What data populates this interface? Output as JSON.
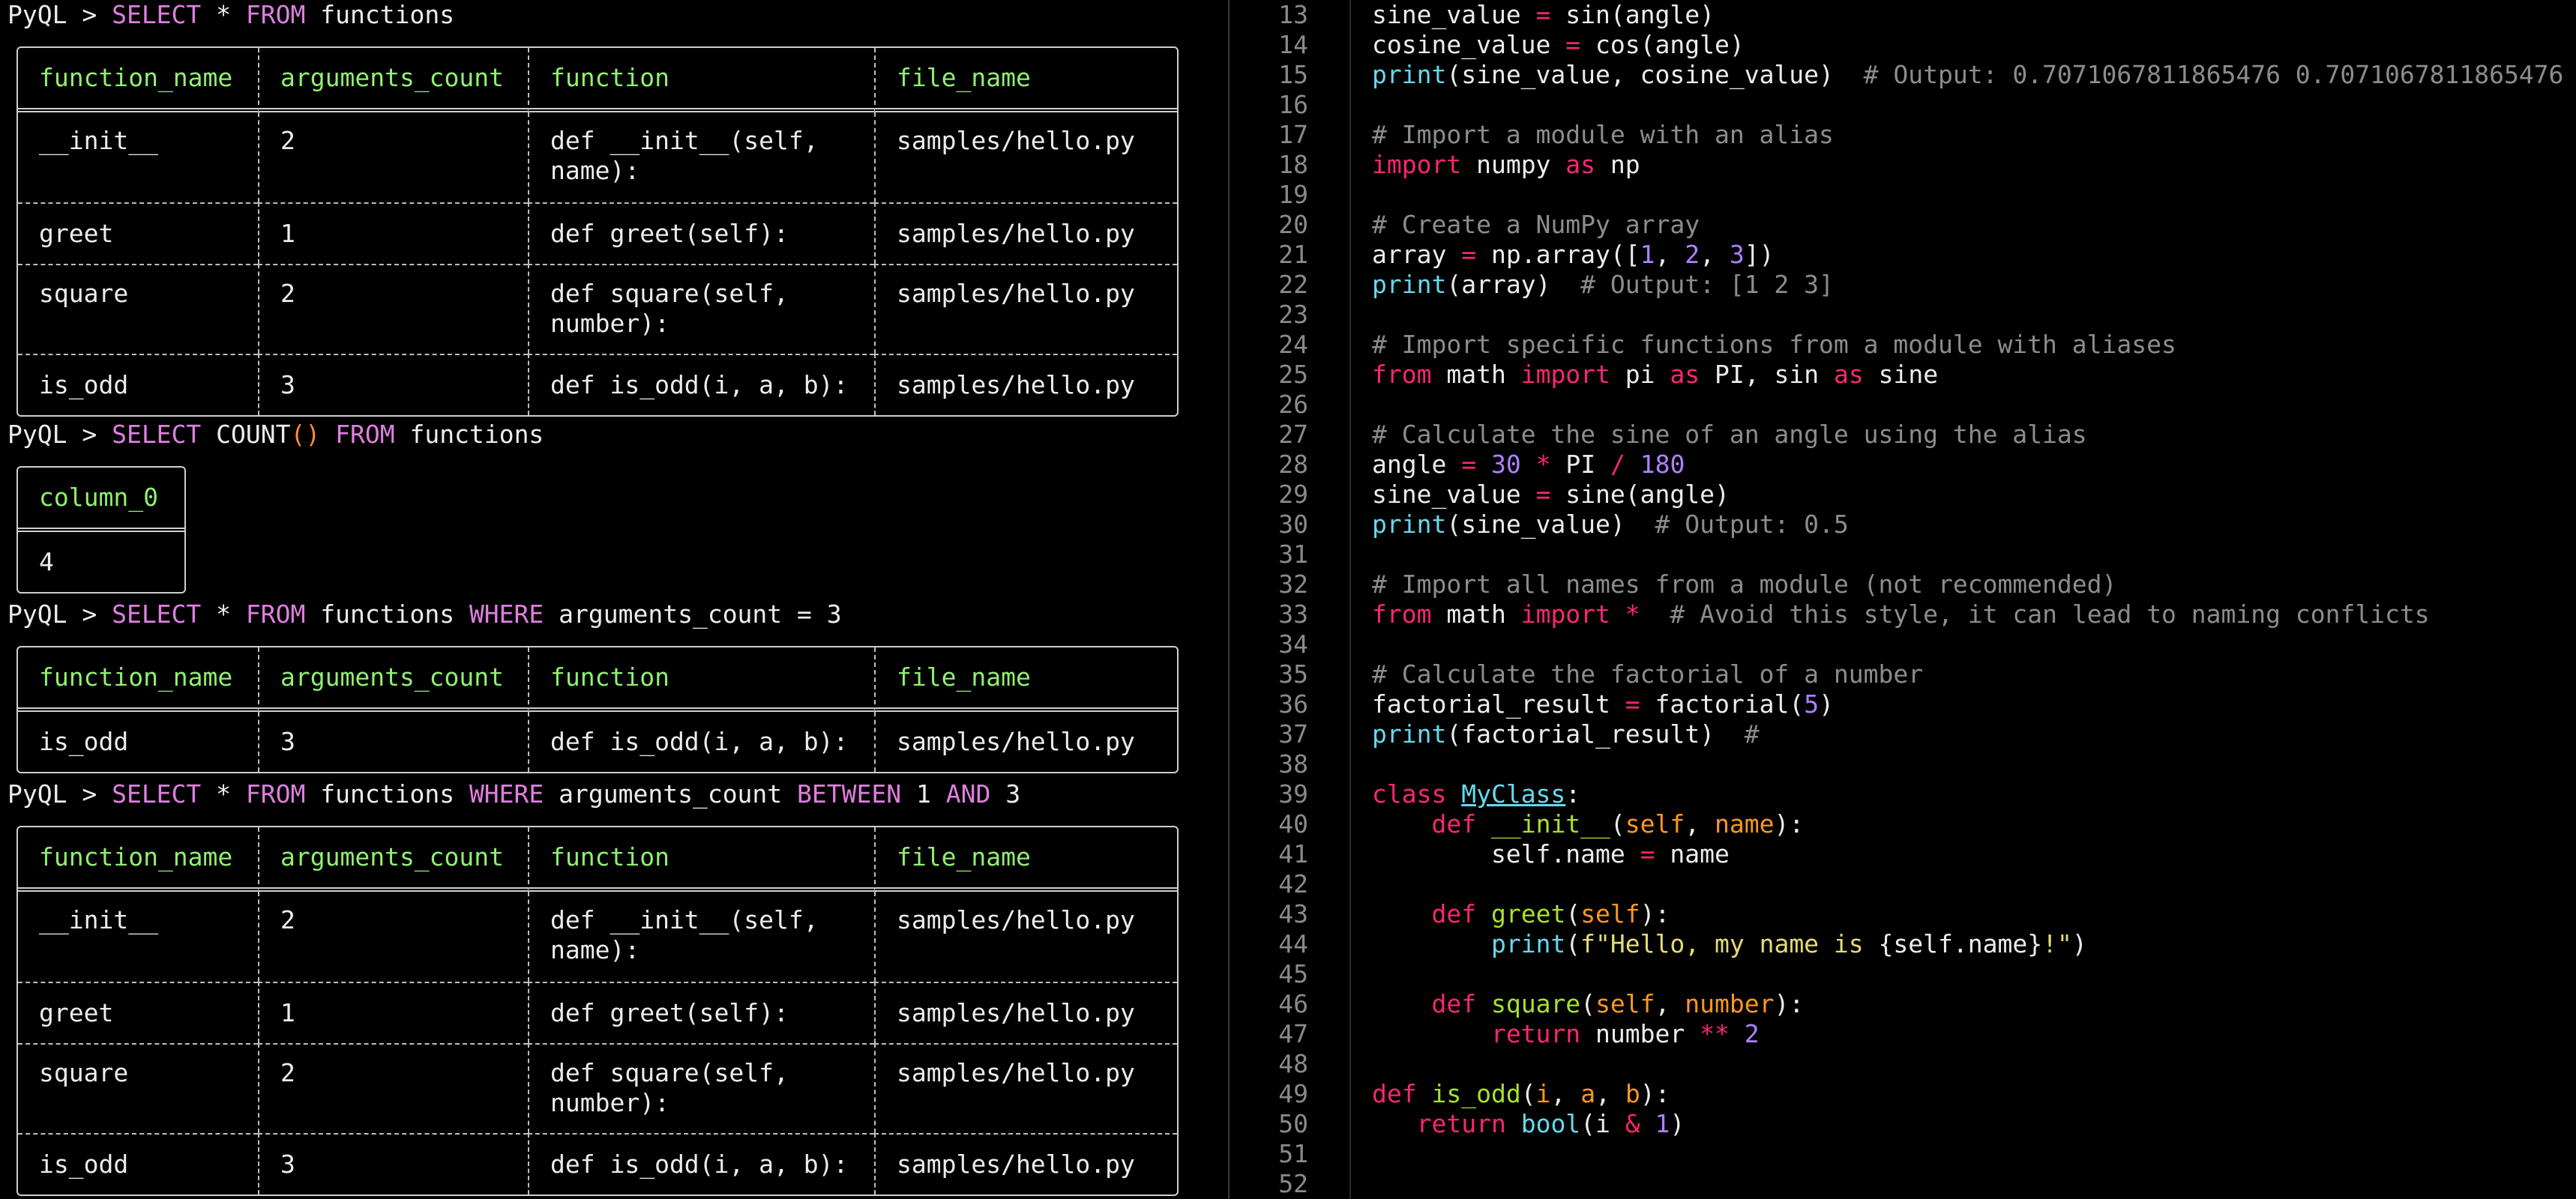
{
  "terminal": {
    "prompt_prefix": "PyQL > ",
    "queries": [
      {
        "select": "SELECT",
        "rest1": " * ",
        "from": "FROM",
        "rest2": " functions"
      },
      {
        "select": "SELECT",
        "rest1": " COUNT",
        "paren": "()",
        "from": "FROM",
        "rest2": " functions"
      },
      {
        "select": "SELECT",
        "rest1": " * ",
        "from": "FROM",
        "rest2": " functions ",
        "where": "WHERE",
        "rest3": " arguments_count = 3"
      },
      {
        "select": "SELECT",
        "rest1": " * ",
        "from": "FROM",
        "rest2": " functions ",
        "where": "WHERE",
        "rest3": " arguments_count ",
        "between": "BETWEEN",
        "rest4": " 1 ",
        "and": "AND",
        "rest5": " 3"
      }
    ],
    "columns": [
      "function_name",
      "arguments_count",
      "function",
      "file_name"
    ],
    "count_column": "column_0",
    "count_value": "4",
    "rows_all": [
      [
        "__init__",
        "2",
        "def __init__(self,\nname):",
        "samples/hello.py"
      ],
      [
        "greet",
        "1",
        "def greet(self):",
        "samples/hello.py"
      ],
      [
        "square",
        "2",
        "def square(self,\nnumber):",
        "samples/hello.py"
      ],
      [
        "is_odd",
        "3",
        "def is_odd(i, a, b):",
        "samples/hello.py"
      ]
    ],
    "rows_where": [
      [
        "is_odd",
        "3",
        "def is_odd(i, a, b):",
        "samples/hello.py"
      ]
    ]
  },
  "editor": {
    "line_numbers": [
      "13",
      "14",
      "15",
      "16",
      "17",
      "18",
      "19",
      "20",
      "21",
      "22",
      "23",
      "24",
      "25",
      "26",
      "27",
      "28",
      "29",
      "30",
      "31",
      "32",
      "33",
      "34",
      "35",
      "36",
      "37",
      "38",
      "39",
      "40",
      "41",
      "42",
      "43",
      "44",
      "45",
      "46",
      "47",
      "48",
      "49",
      "50",
      "51",
      "52"
    ],
    "lines": [
      [
        [
          "sine_value ",
          ""
        ],
        [
          "=",
          "o"
        ],
        [
          " sin(angle)",
          ""
        ]
      ],
      [
        [
          "cosine_value ",
          ""
        ],
        [
          "=",
          "o"
        ],
        [
          " cos(angle)",
          ""
        ]
      ],
      [
        [
          "print",
          "f"
        ],
        [
          "(sine_value, cosine_value)  ",
          ""
        ],
        [
          "# Output: 0.7071067811865476 0.7071067811865476",
          "c"
        ]
      ],
      [],
      [
        [
          "# Import a module with an alias",
          "c"
        ]
      ],
      [
        [
          "import",
          "k"
        ],
        [
          " numpy ",
          ""
        ],
        [
          "as",
          "k"
        ],
        [
          " np",
          ""
        ]
      ],
      [],
      [
        [
          "# Create a NumPy array",
          "c"
        ]
      ],
      [
        [
          "array ",
          ""
        ],
        [
          "=",
          "o"
        ],
        [
          " np.array([",
          ""
        ],
        [
          "1",
          "n"
        ],
        [
          ", ",
          ""
        ],
        [
          "2",
          "n"
        ],
        [
          ", ",
          ""
        ],
        [
          "3",
          "n"
        ],
        [
          "])",
          ""
        ]
      ],
      [
        [
          "print",
          "f"
        ],
        [
          "(array)  ",
          ""
        ],
        [
          "# Output: [1 2 3]",
          "c"
        ]
      ],
      [],
      [
        [
          "# Import specific functions from a module with aliases",
          "c"
        ]
      ],
      [
        [
          "from",
          "k"
        ],
        [
          " math ",
          ""
        ],
        [
          "import",
          "k"
        ],
        [
          " pi ",
          ""
        ],
        [
          "as",
          "k"
        ],
        [
          " PI, sin ",
          ""
        ],
        [
          "as",
          "k"
        ],
        [
          " sine",
          ""
        ]
      ],
      [],
      [
        [
          "# Calculate the sine of an angle using the alias",
          "c"
        ]
      ],
      [
        [
          "angle ",
          ""
        ],
        [
          "=",
          "o"
        ],
        [
          " ",
          ""
        ],
        [
          "30",
          "n"
        ],
        [
          " ",
          ""
        ],
        [
          "*",
          "o"
        ],
        [
          " PI ",
          ""
        ],
        [
          "/",
          "o"
        ],
        [
          " ",
          ""
        ],
        [
          "180",
          "n"
        ]
      ],
      [
        [
          "sine_value ",
          ""
        ],
        [
          "=",
          "o"
        ],
        [
          " sine(angle)",
          ""
        ]
      ],
      [
        [
          "print",
          "f"
        ],
        [
          "(sine_value)  ",
          ""
        ],
        [
          "# Output: 0.5",
          "c"
        ]
      ],
      [],
      [
        [
          "# Import all names from a module (not recommended)",
          "c"
        ]
      ],
      [
        [
          "from",
          "k"
        ],
        [
          " math ",
          ""
        ],
        [
          "import",
          "k"
        ],
        [
          " ",
          ""
        ],
        [
          "*",
          "o"
        ],
        [
          "  ",
          ""
        ],
        [
          "# Avoid this style, it can lead to naming conflicts",
          "c"
        ]
      ],
      [],
      [
        [
          "# Calculate the factorial of a number",
          "c"
        ]
      ],
      [
        [
          "factorial_result ",
          ""
        ],
        [
          "=",
          "o"
        ],
        [
          " factorial(",
          ""
        ],
        [
          "5",
          "n"
        ],
        [
          ")",
          ""
        ]
      ],
      [
        [
          "print",
          "f"
        ],
        [
          "(factorial_result)  ",
          ""
        ],
        [
          "#",
          "c"
        ]
      ],
      [],
      [
        [
          "class",
          "k"
        ],
        [
          " ",
          ""
        ],
        [
          "MyClass",
          "cls"
        ],
        [
          ":",
          ""
        ]
      ],
      [
        [
          "    ",
          ""
        ],
        [
          "def",
          "k"
        ],
        [
          " ",
          ""
        ],
        [
          "__init__",
          "g"
        ],
        [
          "(",
          ""
        ],
        [
          "self",
          "p"
        ],
        [
          ", ",
          ""
        ],
        [
          "name",
          "p"
        ],
        [
          "):",
          ""
        ]
      ],
      [
        [
          "        self.name ",
          ""
        ],
        [
          "=",
          "o"
        ],
        [
          " name",
          ""
        ]
      ],
      [],
      [
        [
          "    ",
          ""
        ],
        [
          "def",
          "k"
        ],
        [
          " ",
          ""
        ],
        [
          "greet",
          "g"
        ],
        [
          "(",
          ""
        ],
        [
          "self",
          "p"
        ],
        [
          "):",
          ""
        ]
      ],
      [
        [
          "        ",
          ""
        ],
        [
          "print",
          "f"
        ],
        [
          "(",
          ""
        ],
        [
          "f\"Hello, my name is ",
          "s"
        ],
        [
          "{self.name}",
          ""
        ],
        [
          "!\"",
          "s"
        ],
        [
          ")",
          ""
        ]
      ],
      [],
      [
        [
          "    ",
          ""
        ],
        [
          "def",
          "k"
        ],
        [
          " ",
          ""
        ],
        [
          "square",
          "g"
        ],
        [
          "(",
          ""
        ],
        [
          "self",
          "p"
        ],
        [
          ", ",
          ""
        ],
        [
          "number",
          "p"
        ],
        [
          "):",
          ""
        ]
      ],
      [
        [
          "        ",
          ""
        ],
        [
          "return",
          "k"
        ],
        [
          " number ",
          ""
        ],
        [
          "**",
          "o"
        ],
        [
          " ",
          ""
        ],
        [
          "2",
          "n"
        ]
      ],
      [],
      [
        [
          "def",
          "k"
        ],
        [
          " ",
          ""
        ],
        [
          "is_odd",
          "g"
        ],
        [
          "(",
          ""
        ],
        [
          "i",
          "p"
        ],
        [
          ", ",
          ""
        ],
        [
          "a",
          "p"
        ],
        [
          ", ",
          ""
        ],
        [
          "b",
          "p"
        ],
        [
          "):",
          ""
        ]
      ],
      [
        [
          "   ",
          ""
        ],
        [
          "return",
          "k"
        ],
        [
          " ",
          ""
        ],
        [
          "bool",
          "f"
        ],
        [
          "(i ",
          ""
        ],
        [
          "&",
          "o"
        ],
        [
          " ",
          ""
        ],
        [
          "1",
          "n"
        ],
        [
          ")",
          ""
        ]
      ],
      [],
      []
    ]
  }
}
